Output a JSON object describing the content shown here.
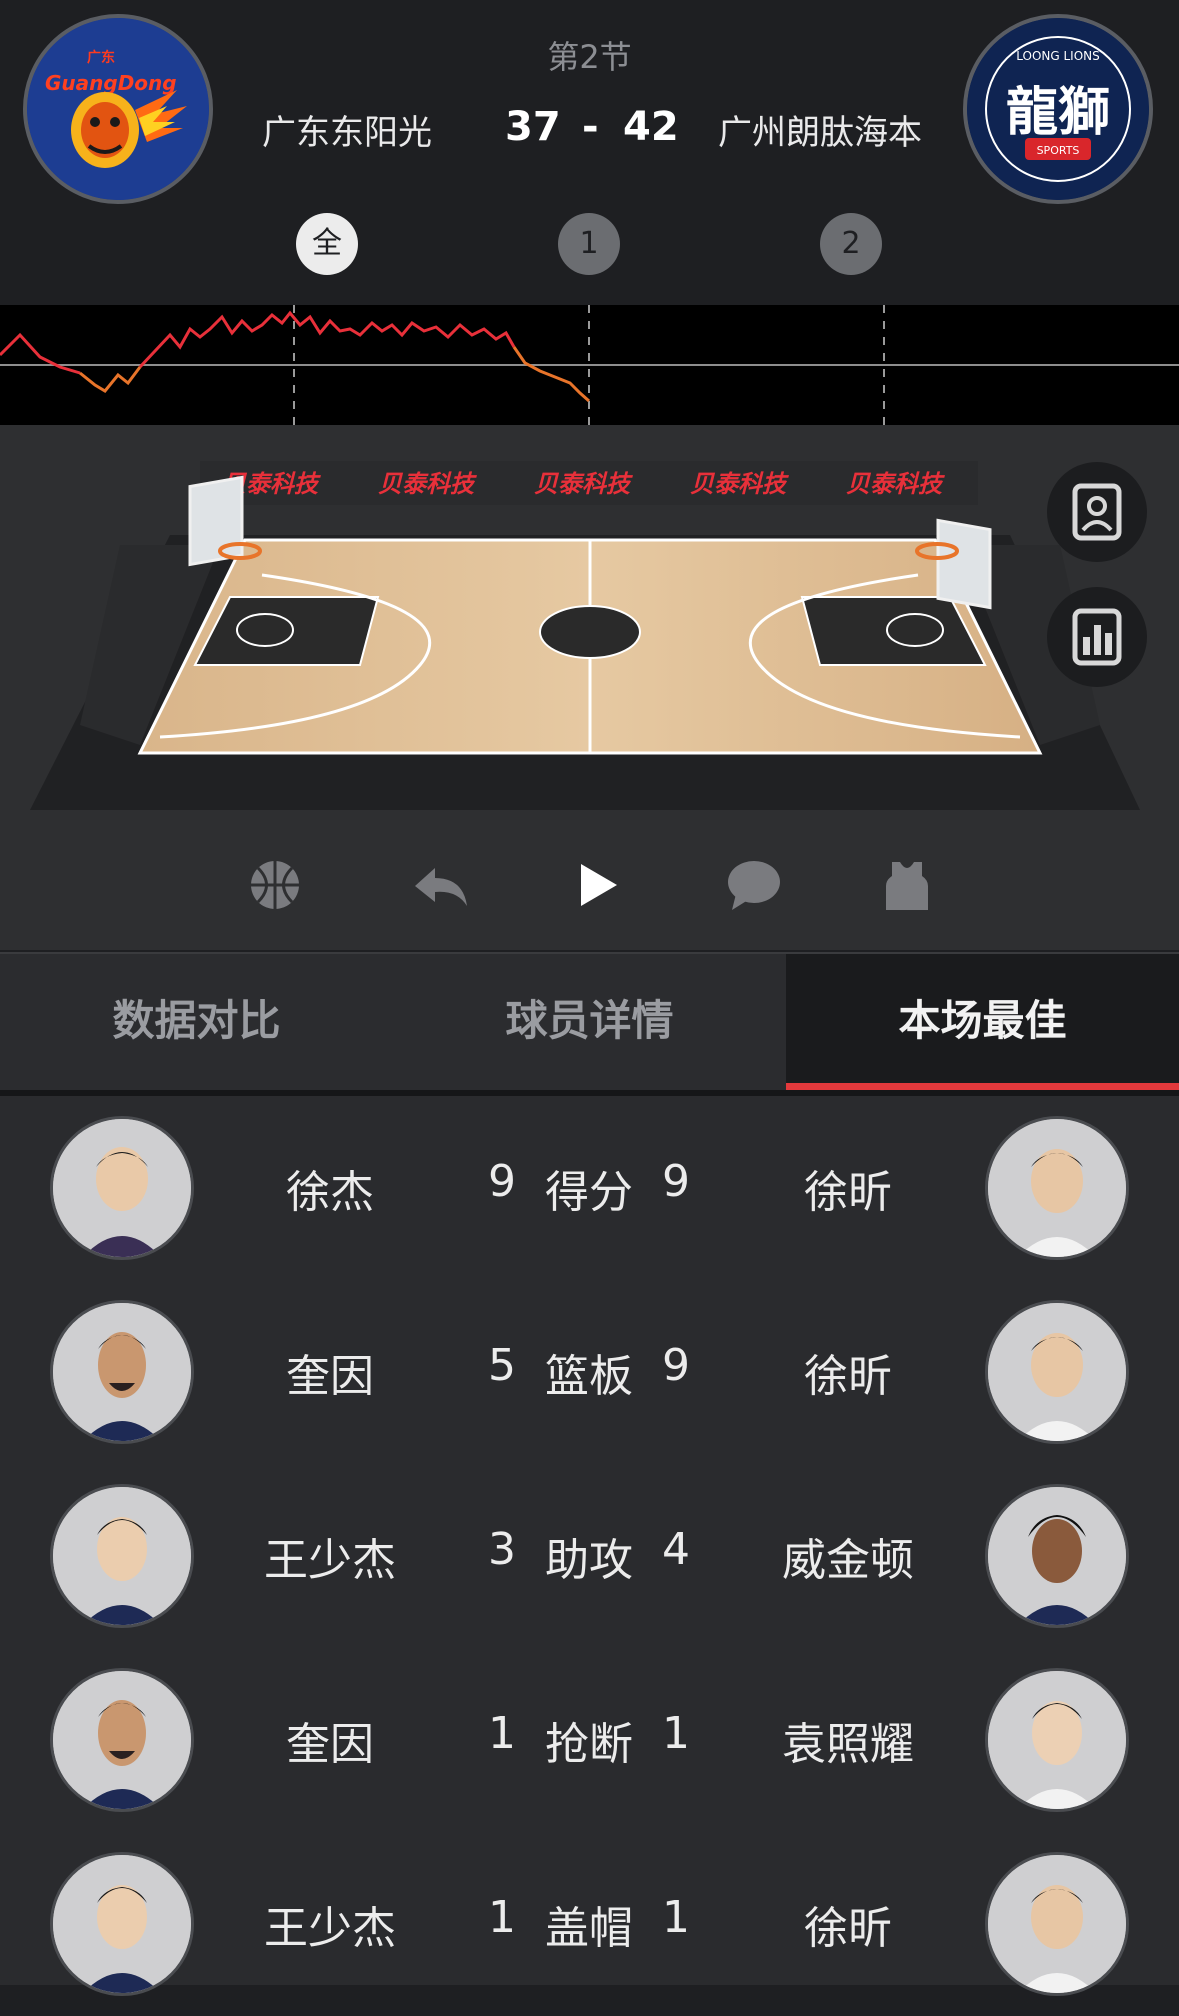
{
  "header": {
    "quarter": "第2节",
    "home_name": "广东东阳光",
    "away_name": "广州朗肽海本",
    "home_score": "37",
    "away_score": "42",
    "score_separator": "-",
    "home_logo_text": "GuangDong",
    "home_logo_sub": "广东",
    "away_logo_text": "龍獅",
    "away_logo_ring": "LOONG LIONS",
    "away_logo_sport": "SPORTS"
  },
  "periods": [
    {
      "label": "全",
      "active": true
    },
    {
      "label": "1",
      "active": false
    },
    {
      "label": "2",
      "active": false
    }
  ],
  "court": {
    "banner_text": "贝泰科技"
  },
  "colors": {
    "accent": "#e3393c",
    "trend_home": "#e8303a",
    "trend_away": "#e8742a"
  },
  "tabs": {
    "compare": "数据对比",
    "players": "球员详情",
    "best": "本场最佳"
  },
  "best": [
    {
      "home_player": "徐杰",
      "home_value": "9",
      "stat": "得分",
      "away_value": "9",
      "away_player": "徐昕"
    },
    {
      "home_player": "奎因",
      "home_value": "5",
      "stat": "篮板",
      "away_value": "9",
      "away_player": "徐昕"
    },
    {
      "home_player": "王少杰",
      "home_value": "3",
      "stat": "助攻",
      "away_value": "4",
      "away_player": "威金顿"
    },
    {
      "home_player": "奎因",
      "home_value": "1",
      "stat": "抢断",
      "away_value": "1",
      "away_player": "袁照耀"
    },
    {
      "home_player": "王少杰",
      "home_value": "1",
      "stat": "盖帽",
      "away_value": "1",
      "away_player": "徐昕"
    }
  ]
}
